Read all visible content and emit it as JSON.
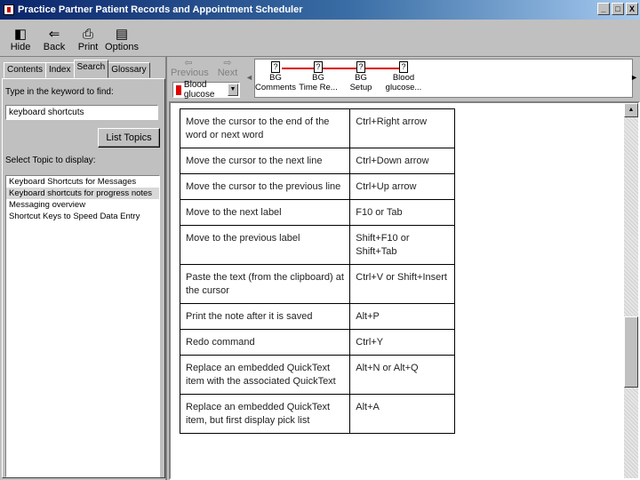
{
  "window": {
    "title": "Practice Partner Patient Records and Appointment Scheduler",
    "min_glyph": "_",
    "max_glyph": "□",
    "close_glyph": "X"
  },
  "toolbar": {
    "hide": "Hide",
    "back": "Back",
    "print": "Print",
    "options": "Options"
  },
  "help_tabs": [
    "Contents",
    "Index",
    "Search",
    "Glossary"
  ],
  "search": {
    "find_label": "Type in the keyword to find:",
    "keyword": "keyboard shortcuts",
    "list_topics": "List Topics",
    "select_label": "Select Topic to display:",
    "topics": [
      "Keyboard Shortcuts for Messages",
      "Keyboard shortcuts for progress notes",
      "Messaging overview",
      "Shortcut Keys to Speed Data Entry"
    ]
  },
  "nav": {
    "previous": "Previous",
    "next": "Next",
    "selector_value": "Blood glucose",
    "trail": [
      {
        "line1": "BG",
        "line2": "Comments"
      },
      {
        "line1": "BG",
        "line2": "Time Re..."
      },
      {
        "line1": "BG",
        "line2": "Setup"
      },
      {
        "line1": "Blood",
        "line2": "glucose..."
      }
    ]
  },
  "shortcuts": [
    {
      "action": "Move the cursor to the end of the word or next word",
      "keys": "Ctrl+Right arrow"
    },
    {
      "action": "Move the cursor to the next line",
      "keys": "Ctrl+Down arrow"
    },
    {
      "action": "Move the cursor to the previous line",
      "keys": "Ctrl+Up arrow"
    },
    {
      "action": "Move to the next label",
      "keys": "F10 or Tab"
    },
    {
      "action": "Move to the previous label",
      "keys": "Shift+F10 or Shift+Tab"
    },
    {
      "action": "Paste the text (from the clipboard) at the cursor",
      "keys": "Ctrl+V or Shift+Insert"
    },
    {
      "action": "Print the note after it is saved",
      "keys": "Alt+P"
    },
    {
      "action": "Redo command",
      "keys": "Ctrl+Y"
    },
    {
      "action": "Replace an embedded QuickText item with the associated QuickText",
      "keys": "Alt+N or Alt+Q"
    },
    {
      "action": "Replace an embedded QuickText item, but first display pick list",
      "keys": "Alt+A"
    }
  ],
  "colors": {
    "titlebar_start": "#0a246a",
    "trail_line": "#e00000",
    "chrome": "#c0c0c0"
  }
}
